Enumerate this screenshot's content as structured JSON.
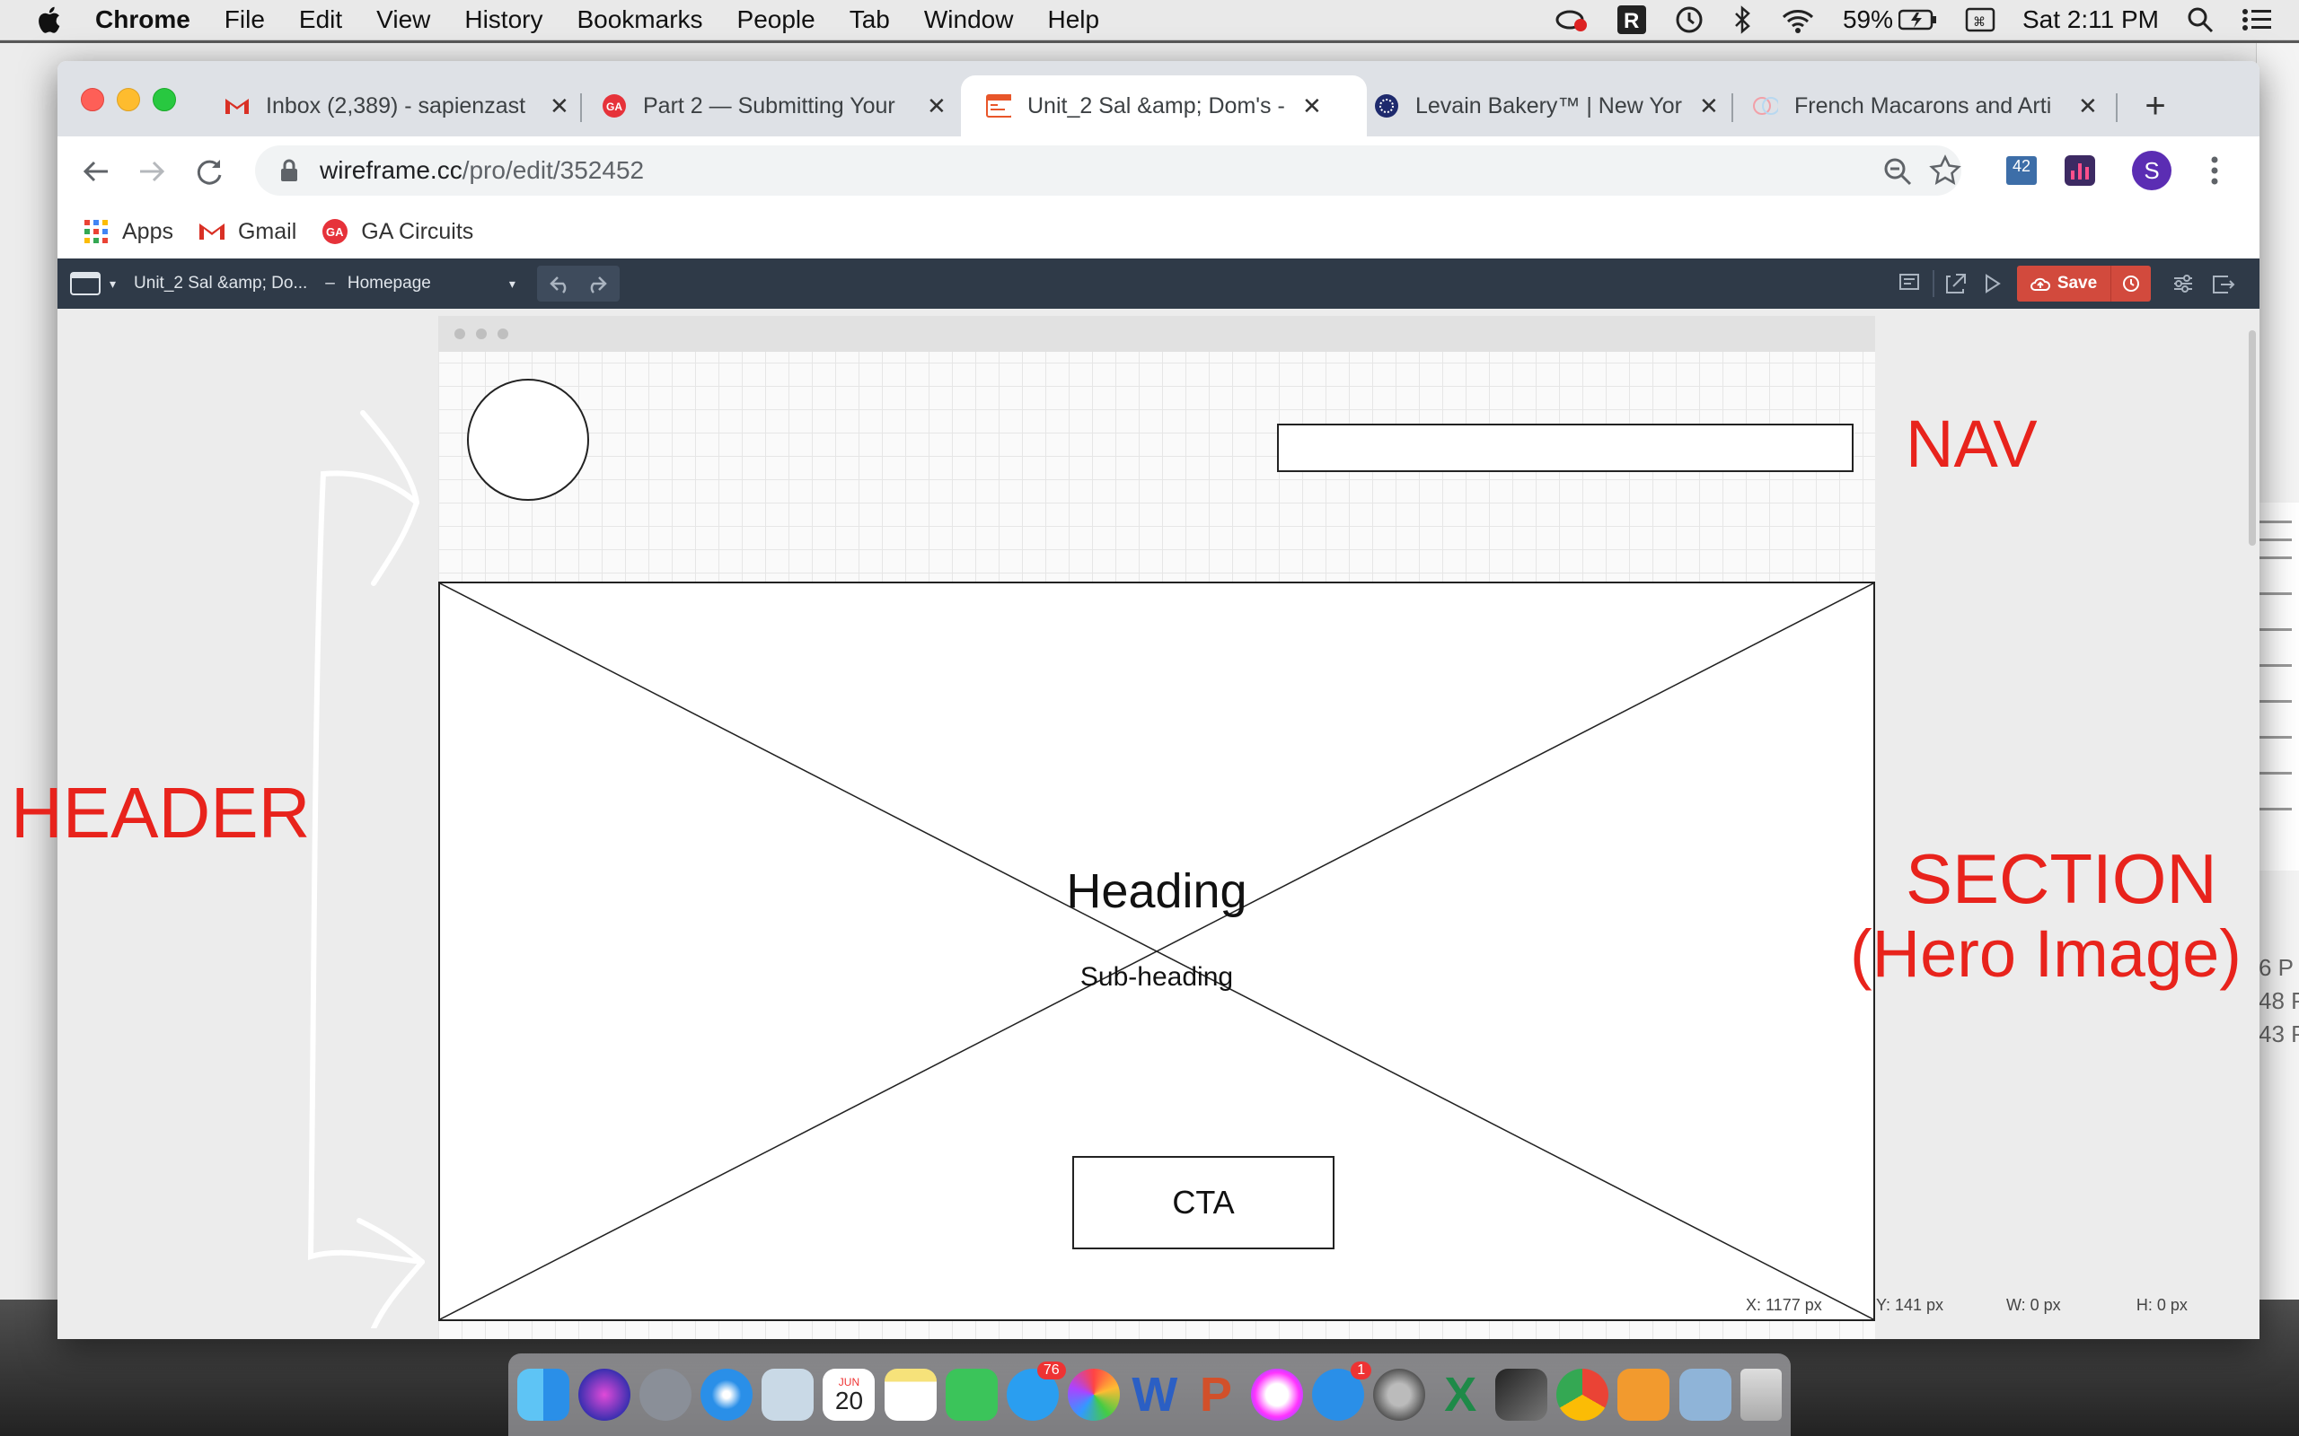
{
  "menubar": {
    "app_name": "Chrome",
    "items": [
      "File",
      "Edit",
      "View",
      "History",
      "Bookmarks",
      "People",
      "Tab",
      "Window",
      "Help"
    ],
    "battery": "59%",
    "clock": "Sat 2:11 PM"
  },
  "tabs": [
    {
      "label": "Inbox (2,389) - sapienzast",
      "icon": "gmail-icon",
      "active": false
    },
    {
      "label": "Part 2 — Submitting Your",
      "icon": "ga-icon",
      "active": false
    },
    {
      "label": "Unit_2 Sal &amp; Dom's -",
      "icon": "wireframe-icon",
      "active": true
    },
    {
      "label": "Levain Bakery™ | New Yor",
      "icon": "levain-icon",
      "active": false
    },
    {
      "label": "French Macarons and Arti",
      "icon": "macaron-icon",
      "active": false
    }
  ],
  "new_tab_label": "+",
  "url": {
    "host": "wireframe.cc",
    "path": "/pro/edit/352452"
  },
  "extension_badge": "42",
  "profile_initial": "S",
  "bookmarks": [
    {
      "label": "Apps",
      "icon": "apps-grid-icon"
    },
    {
      "label": "Gmail",
      "icon": "gmail-icon"
    },
    {
      "label": "GA Circuits",
      "icon": "ga-icon"
    }
  ],
  "app_header": {
    "project": "Unit_2 Sal &amp; Do...",
    "separator": "–",
    "page": "Homepage",
    "save_label": "Save"
  },
  "wireframe": {
    "heading": "Heading",
    "subheading": "Sub-heading",
    "cta": "CTA"
  },
  "coords": {
    "x": "X: 1177 px",
    "y": "Y: 141 px",
    "w": "W: 0 px",
    "h": "H: 0 px"
  },
  "annotations": {
    "nav": "NAV",
    "header": "HEADER",
    "section": "SECTION",
    "section_sub": "(Hero Image)",
    "color": "#e8231c"
  },
  "bg_doc_text": [
    "6 P",
    "48 P",
    "43 P"
  ],
  "dock": {
    "apps": [
      "finder",
      "siri",
      "launchpad",
      "safari",
      "preview",
      "calendar",
      "notes",
      "facetime",
      "messages",
      "photos",
      "word",
      "powerpoint",
      "itunes",
      "app-store",
      "system-preferences",
      "excel",
      "final-cut",
      "chrome",
      "sublime",
      "image-capture",
      "trash"
    ],
    "calendar_month": "JUN",
    "calendar_day": "20",
    "messages_badge": "76",
    "appstore_badge": "1"
  }
}
